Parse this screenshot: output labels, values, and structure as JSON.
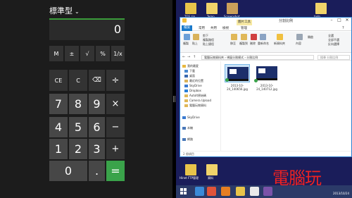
{
  "calculator": {
    "mode_label": "標準型",
    "display": "0",
    "keys": {
      "mem": "M",
      "plusminus": "±",
      "sqrt": "√",
      "percent": "%",
      "reciprocal": "1/x",
      "ce": "CE",
      "c": "C",
      "backspace": "⌫",
      "divide": "÷",
      "n7": "7",
      "n8": "8",
      "n9": "9",
      "multiply": "×",
      "n4": "4",
      "n5": "5",
      "n6": "6",
      "minus": "−",
      "n1": "1",
      "n2": "2",
      "n3": "3",
      "plus": "+",
      "n0": "0",
      "dot": ".",
      "equals": "="
    }
  },
  "explorer": {
    "title": "分割比例",
    "ribbon_tabs": [
      "檔案",
      "常用",
      "共用",
      "檢視",
      "管理"
    ],
    "context_tab": "圖片工具",
    "ribbon_left": [
      "複製",
      "貼上",
      "剪下",
      "複製路徑",
      "貼上捷徑"
    ],
    "ribbon_mid": [
      "移至",
      "複製到",
      "刪除",
      "重新命名"
    ],
    "ribbon_right": [
      "新資料夾",
      "內容",
      "開啟",
      "全選",
      "全部不選",
      "反向選擇"
    ],
    "address": "電腦玩物資料夾 › 視窗分割模式 › 分割比例",
    "search_placeholder": "搜尋 分割比例",
    "nav_items": [
      "我的最愛",
      "下載",
      "桌面",
      "最近的位置",
      "SkyDrive",
      "Dropbox",
      "AutoIt原始碼",
      "Camera Upload",
      "電腦玩物資料",
      "SkyDrive",
      "本機",
      "網路"
    ],
    "files": [
      {
        "name": "2013-10-24_140656.jpg"
      },
      {
        "name": "2013-10-24_140712.jpg"
      }
    ],
    "status": "2 個項目"
  },
  "desktop": {
    "icons": [
      {
        "label": "TGS.zip"
      },
      {
        "label": "Temp"
      },
      {
        "label": "Screenshot"
      },
      {
        "label": "todo"
      },
      {
        "label": "Hinet FTP管理"
      },
      {
        "label": "資料"
      }
    ]
  },
  "watermark": "電腦玩",
  "taskbar": {
    "clock": "2013/10/24"
  }
}
